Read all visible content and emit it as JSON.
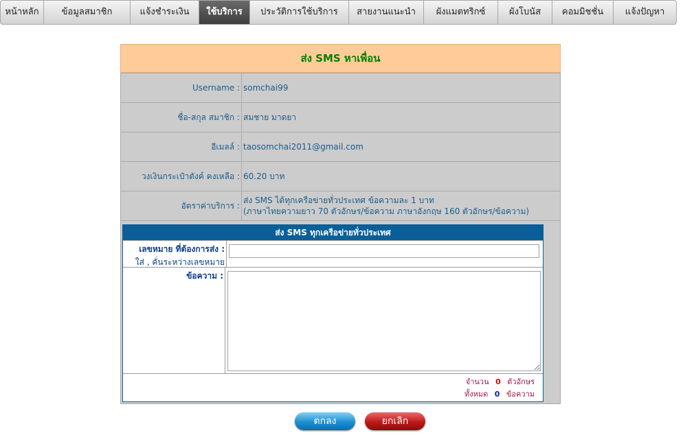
{
  "nav": {
    "items": [
      {
        "label": "หน้าหลัก",
        "active": false
      },
      {
        "label": "ข้อมูลสมาชิก",
        "active": false
      },
      {
        "label": "แจ้งชำระเงิน",
        "active": false
      },
      {
        "label": "ใช้บริการ",
        "active": true
      },
      {
        "label": "ประวัติการใช้บริการ",
        "active": false
      },
      {
        "label": "สายงานแนะนำ",
        "active": false
      },
      {
        "label": "ผังแมตทริกซ์",
        "active": false
      },
      {
        "label": "ผังโบนัส",
        "active": false
      },
      {
        "label": "คอมมิชชั่น",
        "active": false
      },
      {
        "label": "แจ้งปัญหา",
        "active": false
      }
    ]
  },
  "panel": {
    "title": "ส่ง SMS หาเพื่อน",
    "username_label": "Username :",
    "username": "somchai99",
    "name_label": "ชื่อ-สกุล สมาชิก :",
    "name": "สมชาย มาดยา",
    "email_label": "อีเมลล์ :",
    "email": "taosomchai2011@gmail.com",
    "balance_label": "วงเงินกระเป๋าตังค์ คงเหลือ :",
    "balance": "60.20 บาท",
    "rate_label": "อัตราค่าบริการ :",
    "rate_line1": "ส่ง SMS ได้ทุกเครือข่ายทั่วประเทศ ข้อความละ 1 บาท",
    "rate_line2": "(ภาษาไทยความยาว 70 ตัวอักษร/ข้อความ ภาษาอังกฤษ 160 ตัวอักษร/ข้อความ)"
  },
  "sms": {
    "header": "ส่ง SMS ทุกเครือข่ายทั่วประเทศ",
    "phone_label": "เลขหมาย ที่ต้องการส่ง :",
    "phone_hint": "ใส่ , คั่นระหว่างเลขหมาย",
    "phone_value": "",
    "message_label": "ข้อความ :",
    "message_value": "",
    "char_count_label": "จำนวน",
    "char_count": "0",
    "char_unit": "ตัวอักษร",
    "msg_count_label": "ทั้งหมด",
    "msg_count": "0",
    "msg_unit": "ข้อความ"
  },
  "buttons": {
    "ok": "ตกลง",
    "cancel": "ยกเลิก"
  }
}
